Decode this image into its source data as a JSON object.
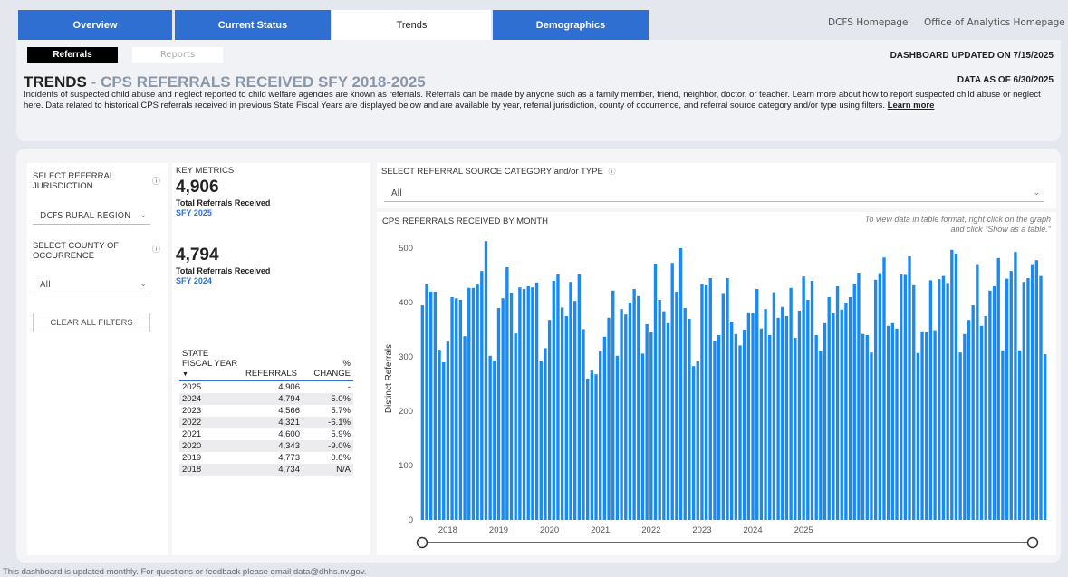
{
  "nav": {
    "tabs": [
      {
        "label": "Overview"
      },
      {
        "label": "Current Status"
      },
      {
        "label": "Trends"
      },
      {
        "label": "Demographics"
      }
    ],
    "links": [
      "DCFS Homepage",
      "Office of Analytics Homepage"
    ]
  },
  "subnav": {
    "tabs": [
      "Referrals",
      "Reports"
    ],
    "dashboard_updated": "DASHBOARD UPDATED ON  7/15/2025",
    "data_as_of": "DATA AS OF 6/30/2025"
  },
  "page": {
    "title_main": "TRENDS",
    "title_sep": "-",
    "title_sub": "CPS REFERRALS RECEIVED SFY 2018-2025",
    "description": "Incidents of suspected child abuse and neglect reported to child welfare agencies are known as referrals. Referrals can be made by anyone such as a family member, friend, neighbor, doctor, or teacher.  Learn more about how to report suspected child abuse or neglect here. Data related to historical CPS referrals received in previous State Fiscal Years are displayed below and are available by year, referral jurisdiction, county of occurrence, and referral source category and/or type using filters.",
    "learn_more": "Learn more"
  },
  "filters": {
    "jurisdiction_label": "SELECT REFERRAL JURISDICTION",
    "jurisdiction_value": "DCFS RURAL REGION",
    "county_label": "SELECT COUNTY OF OCCURRENCE",
    "county_value": "All",
    "clear_label": "CLEAR ALL FILTERS",
    "info_icon": "info-icon"
  },
  "key_metrics": {
    "title": "KEY METRICS",
    "m1_value": "4,906",
    "m1_label": "Total Referrals Received",
    "m1_sub": "SFY 2025",
    "m2_value": "4,794",
    "m2_label": "Total Referrals Received",
    "m2_sub": "SFY 2024"
  },
  "table": {
    "headers": [
      "STATE FISCAL YEAR",
      "REFERRALS",
      "% CHANGE"
    ],
    "rows": [
      [
        "2025",
        "4,906",
        "-"
      ],
      [
        "2024",
        "4,794",
        "5.0%"
      ],
      [
        "2023",
        "4,566",
        "5.7%"
      ],
      [
        "2022",
        "4,321",
        "-6.1%"
      ],
      [
        "2021",
        "4,600",
        "5.9%"
      ],
      [
        "2020",
        "4,343",
        "-9.0%"
      ],
      [
        "2019",
        "4,773",
        "0.8%"
      ],
      [
        "2018",
        "4,734",
        "N/A"
      ]
    ]
  },
  "source_filter": {
    "label": "SELECT REFERRAL SOURCE CATEGORY and/or TYPE",
    "value": "All"
  },
  "chart_title": "CPS REFERRALS RECEIVED BY MONTH",
  "chart_note": [
    "To view data in table format, right click on the graph",
    "and click \"Show as a table.\""
  ],
  "chart_data": {
    "type": "bar",
    "ylabel": "Distinct Referrals",
    "ylim": [
      0,
      520
    ],
    "yticks": [
      0,
      100,
      200,
      300,
      400,
      500
    ],
    "xtick_labels": [
      "2018",
      "2019",
      "2020",
      "2021",
      "2022",
      "2023",
      "2024",
      "2025"
    ],
    "bar_color": "#1a8af0",
    "values": [
      395,
      435,
      420,
      420,
      313,
      290,
      328,
      410,
      408,
      405,
      338,
      427,
      427,
      433,
      458,
      513,
      302,
      293,
      390,
      408,
      465,
      417,
      343,
      428,
      425,
      430,
      428,
      437,
      292,
      316,
      368,
      440,
      452,
      391,
      375,
      438,
      403,
      452,
      351,
      260,
      275,
      268,
      310,
      337,
      372,
      422,
      302,
      388,
      378,
      400,
      425,
      412,
      306,
      360,
      345,
      470,
      405,
      384,
      362,
      473,
      420,
      500,
      390,
      370,
      283,
      292,
      434,
      432,
      445,
      330,
      340,
      416,
      445,
      365,
      342,
      321,
      350,
      382,
      380,
      425,
      352,
      388,
      340,
      419,
      372,
      392,
      375,
      427,
      335,
      385,
      448,
      405,
      440,
      340,
      311,
      362,
      410,
      380,
      430,
      387,
      400,
      410,
      435,
      455,
      342,
      340,
      308,
      442,
      454,
      483,
      357,
      362,
      352,
      452,
      451,
      485,
      432,
      307,
      347,
      345,
      441,
      349,
      443,
      449,
      436,
      497,
      490,
      308,
      342,
      368,
      395,
      469,
      357,
      375,
      422,
      430,
      482,
      312,
      444,
      458,
      493,
      312,
      438,
      445,
      469,
      478,
      449,
      305
    ],
    "slider": "range-slider"
  },
  "footer": "This dashboard is updated monthly. For questions or feedback please email data@dhhs.nv.gov."
}
